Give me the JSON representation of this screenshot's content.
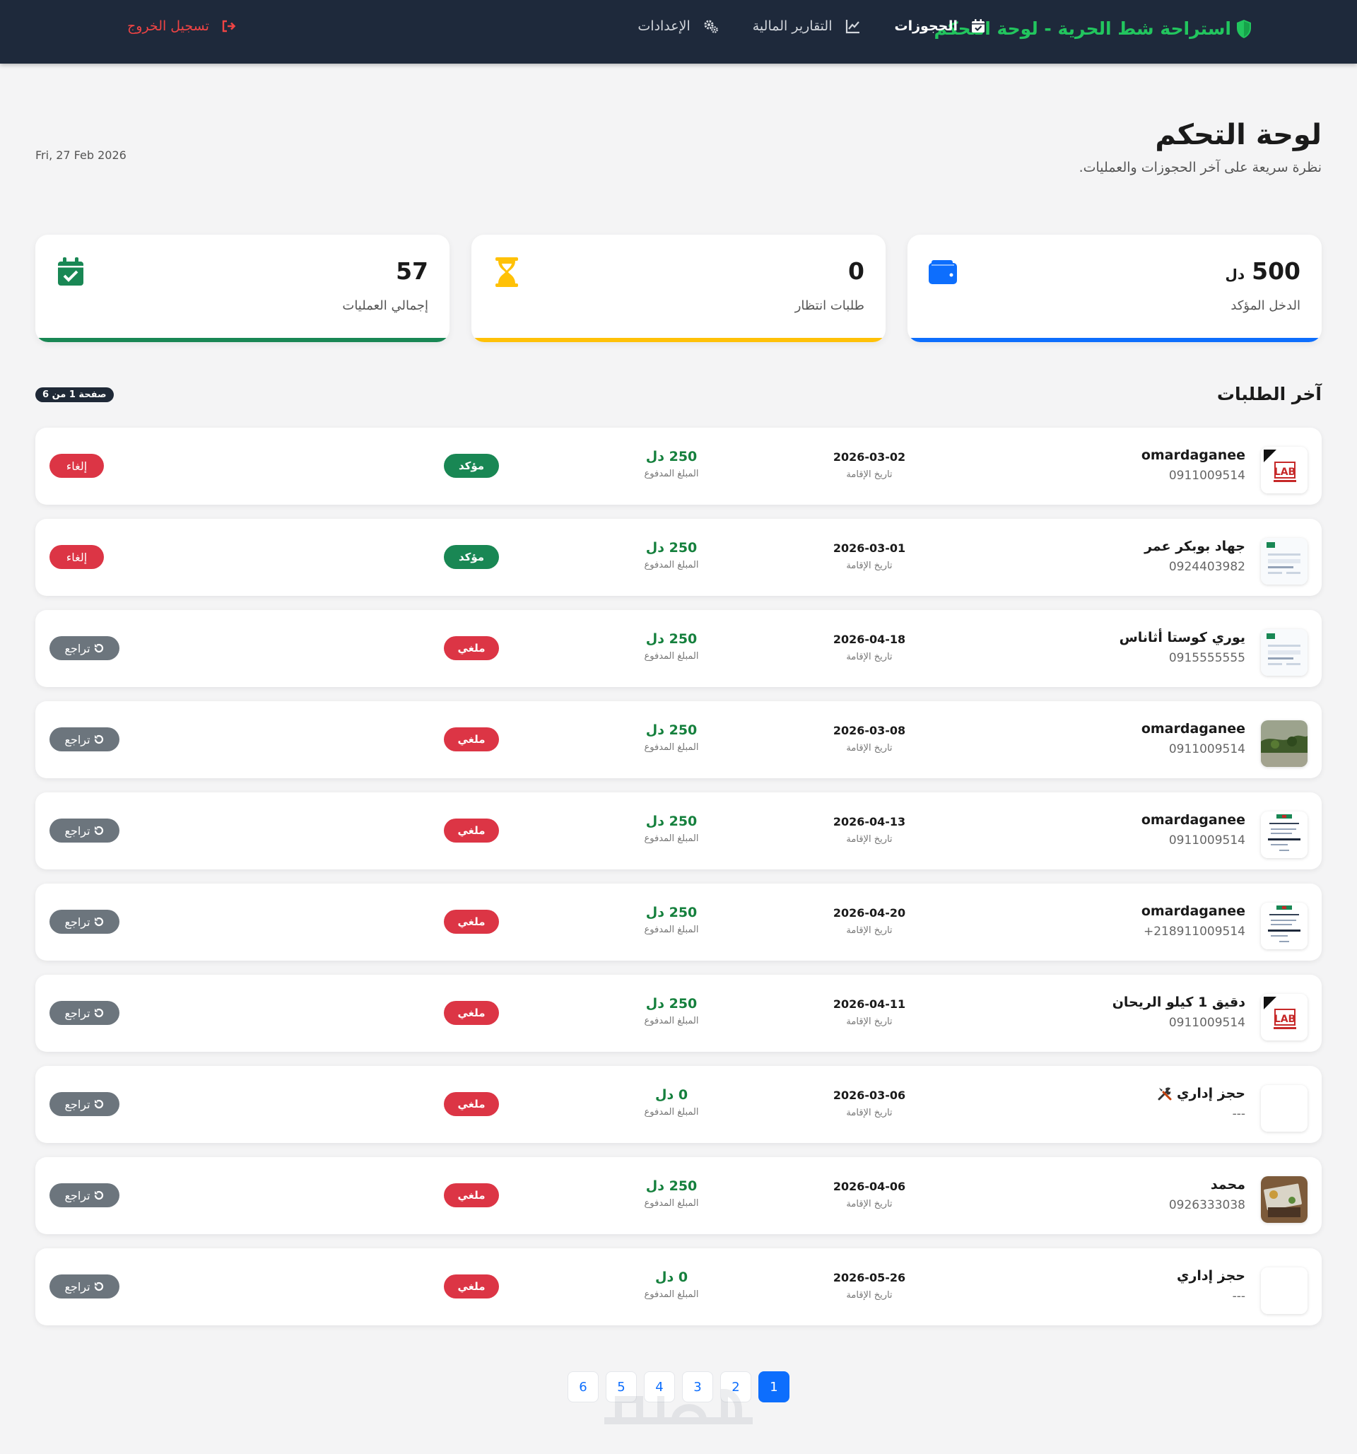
{
  "navbar": {
    "brand": "استراحة شط الحرية - لوحة التحكم",
    "links": [
      {
        "label": "الحجوزات",
        "icon": "calendar-check-icon"
      },
      {
        "label": "التقارير المالية",
        "icon": "chart-line-icon"
      },
      {
        "label": "الإعدادات",
        "icon": "gears-icon"
      }
    ],
    "logout": "تسجيل الخروج",
    "colors": {
      "bg": "#1e293b",
      "brand": "#22c55e",
      "logout": "#ef4444"
    }
  },
  "header": {
    "title": "لوحة التحكم",
    "subtitle": "نظرة سريعة على آخر الحجوزات والعمليات.",
    "date": "Fri, 27 Feb 2026"
  },
  "stats": [
    {
      "value": "500",
      "unit": "دل",
      "label": "الدخل المؤكد",
      "icon": "wallet-icon",
      "color": "#0d6efd"
    },
    {
      "value": "0",
      "label": "طلبات انتظار",
      "icon": "hourglass-icon",
      "color": "#ffc107"
    },
    {
      "value": "57",
      "label": "إجمالي العمليات",
      "icon": "calendar-check-icon",
      "color": "#198754"
    }
  ],
  "requests": {
    "title": "آخر الطلبات",
    "page_badge": "صفحة 1 من 6",
    "date_label": "تاريخ الإقامة",
    "amount_label": "المبلغ المدفوع",
    "rows": [
      {
        "name": "omardaganee",
        "phone": "0911009514",
        "date": "2026-03-02",
        "amount": "250 دل",
        "status": "مؤكد",
        "status_type": "confirmed",
        "action": "إلغاء",
        "action_type": "cancel",
        "thumb": "lab"
      },
      {
        "name": "جهاد بوبكر عمر",
        "phone": "0924403982",
        "date": "2026-03-01",
        "amount": "250 دل",
        "status": "مؤكد",
        "status_type": "confirmed",
        "action": "إلغاء",
        "action_type": "cancel",
        "thumb": "doc"
      },
      {
        "name": "يوري كوستا أثاناس",
        "phone": "0915555555",
        "date": "2026-04-18",
        "amount": "250 دل",
        "status": "ملغي",
        "status_type": "cancelled",
        "action": "تراجع",
        "action_type": "revert",
        "thumb": "doc"
      },
      {
        "name": "omardaganee",
        "phone": "0911009514",
        "date": "2026-03-08",
        "amount": "250 دل",
        "status": "ملغي",
        "status_type": "cancelled",
        "action": "تراجع",
        "action_type": "revert",
        "thumb": "photo"
      },
      {
        "name": "omardaganee",
        "phone": "0911009514",
        "date": "2026-04-13",
        "amount": "250 دل",
        "status": "ملغي",
        "status_type": "cancelled",
        "action": "تراجع",
        "action_type": "revert",
        "thumb": "receipt"
      },
      {
        "name": "omardaganee",
        "phone": "+218911009514",
        "date": "2026-04-20",
        "amount": "250 دل",
        "status": "ملغي",
        "status_type": "cancelled",
        "action": "تراجع",
        "action_type": "revert",
        "thumb": "receipt"
      },
      {
        "name": "دقيق 1 كيلو الريحان",
        "phone": "0911009514",
        "date": "2026-04-11",
        "amount": "250 دل",
        "status": "ملغي",
        "status_type": "cancelled",
        "action": "تراجع",
        "action_type": "revert",
        "thumb": "lab"
      },
      {
        "name": "حجز إداري",
        "phone": "---",
        "date": "2026-03-06",
        "amount": "0 دل",
        "status": "ملغي",
        "status_type": "cancelled",
        "action": "تراجع",
        "action_type": "revert",
        "thumb": "blank",
        "tools_icon": true
      },
      {
        "name": "محمد",
        "phone": "0926333038",
        "date": "2026-04-06",
        "amount": "250 دل",
        "status": "ملغي",
        "status_type": "cancelled",
        "action": "تراجع",
        "action_type": "revert",
        "thumb": "money"
      },
      {
        "name": "حجز إداري",
        "phone": "---",
        "date": "2026-05-26",
        "amount": "0 دل",
        "status": "ملغي",
        "status_type": "cancelled",
        "action": "تراجع",
        "action_type": "revert",
        "thumb": "blank"
      }
    ]
  },
  "pagination": {
    "pages": [
      "1",
      "2",
      "3",
      "4",
      "5",
      "6"
    ],
    "current": "1"
  }
}
